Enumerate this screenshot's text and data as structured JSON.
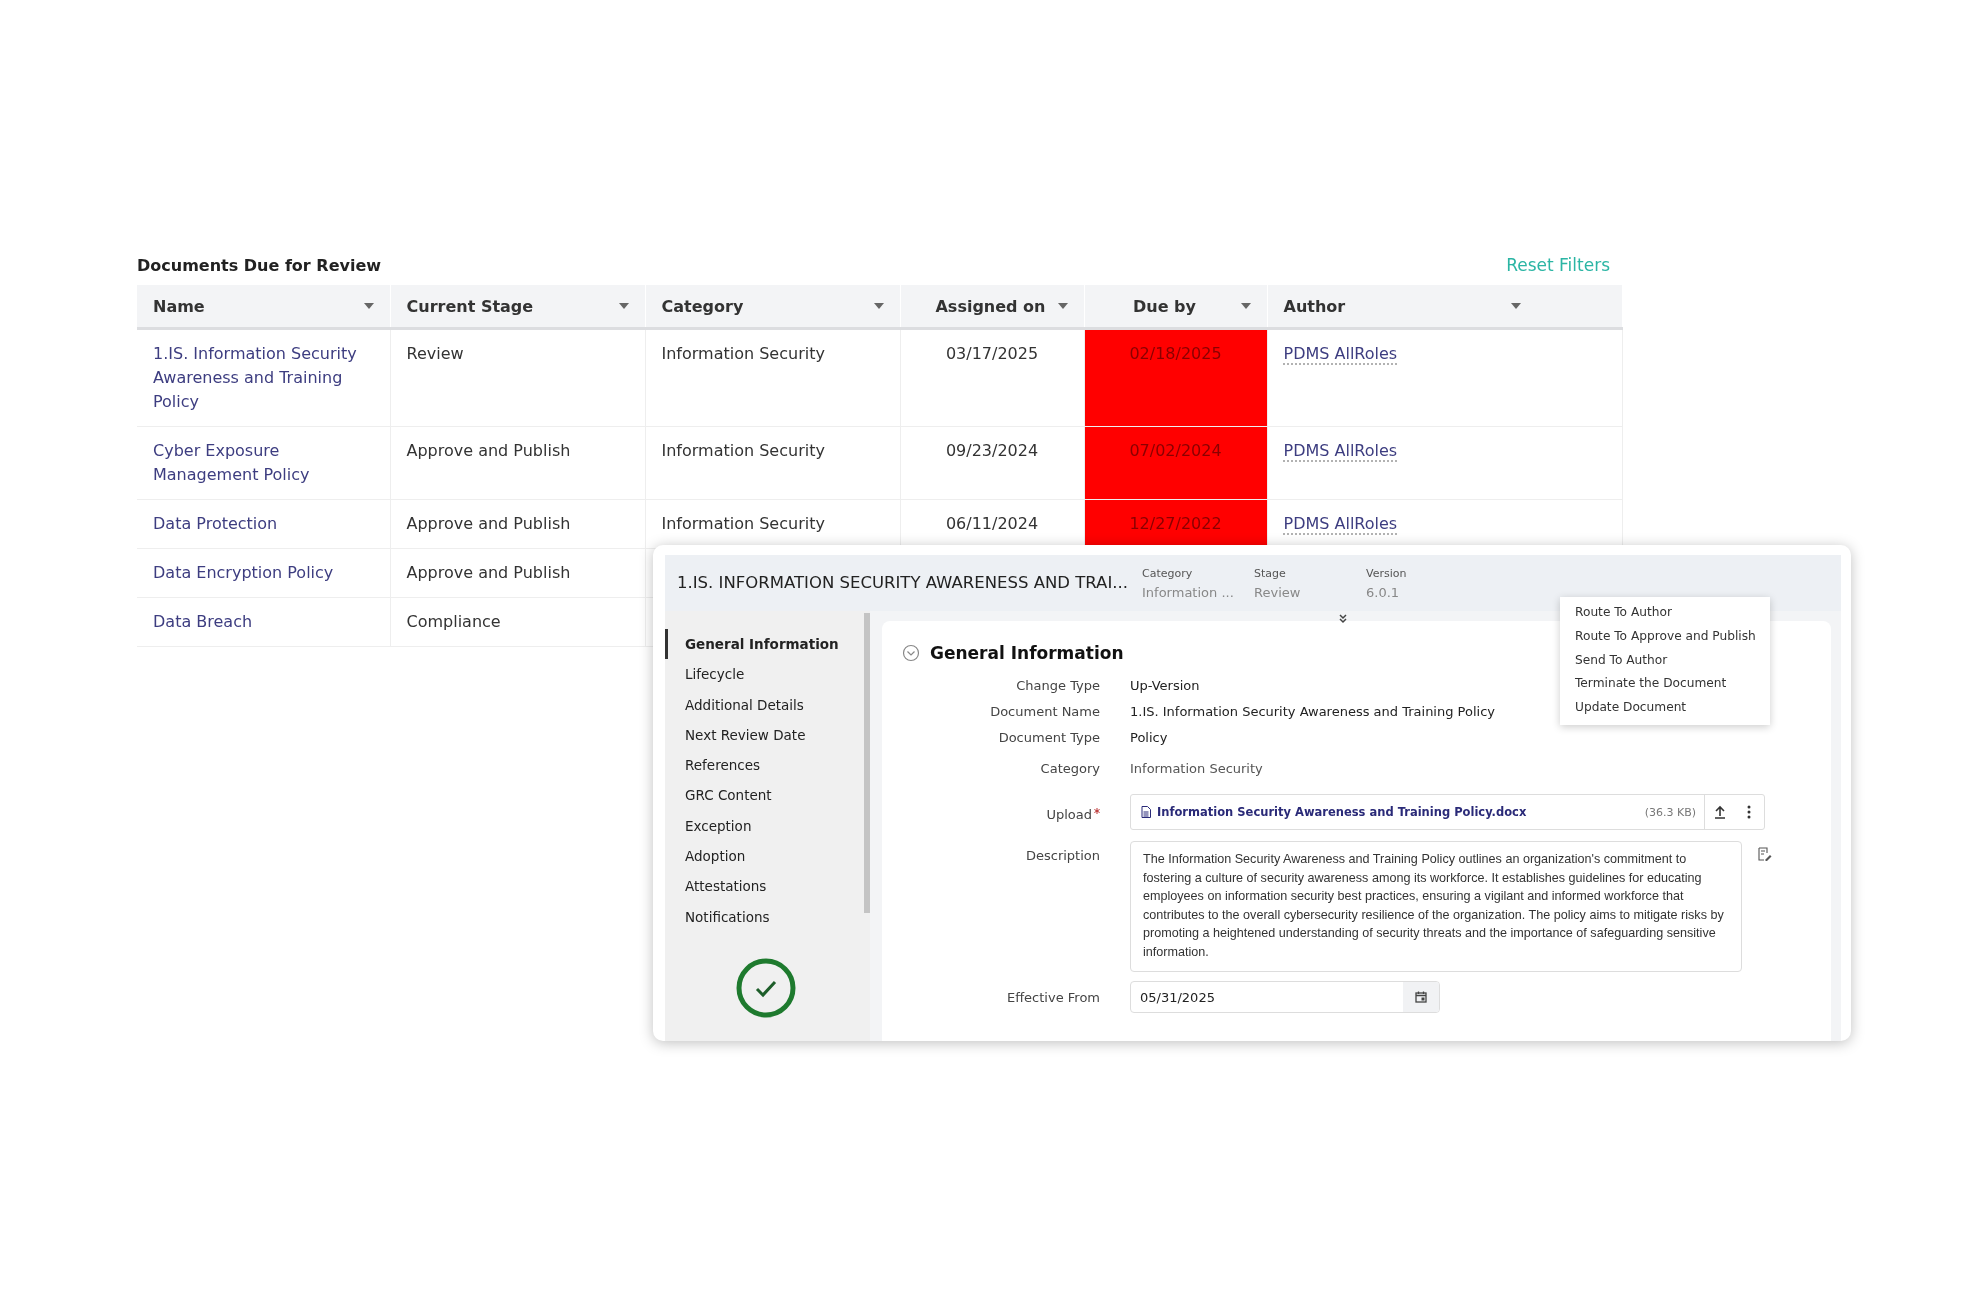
{
  "review_table": {
    "title": "Documents Due for Review",
    "reset_link": "Reset Filters",
    "columns": [
      {
        "label": "Name"
      },
      {
        "label": "Current Stage"
      },
      {
        "label": "Category"
      },
      {
        "label": "Assigned on"
      },
      {
        "label": "Due by"
      },
      {
        "label": "Author"
      }
    ],
    "rows": [
      {
        "name": "1.IS. Information Security Awareness and Training Policy",
        "current_stage": "Review",
        "category": "Information Security",
        "assigned_on": "03/17/2025",
        "due_by": "02/18/2025",
        "overdue": true,
        "author": "PDMS AllRoles"
      },
      {
        "name": "Cyber Exposure Management Policy",
        "current_stage": "Approve and Publish",
        "category": "Information Security",
        "assigned_on": "09/23/2024",
        "due_by": "07/02/2024",
        "overdue": true,
        "author": "PDMS AllRoles"
      },
      {
        "name": "Data Protection",
        "current_stage": "Approve and Publish",
        "category": "Information Security",
        "assigned_on": "06/11/2024",
        "due_by": "12/27/2022",
        "overdue": true,
        "author": "PDMS AllRoles"
      },
      {
        "name": "Data Encryption Policy",
        "current_stage": "Approve and Publish"
      },
      {
        "name": "Data Breach",
        "current_stage": "Compliance"
      }
    ]
  },
  "detail_panel": {
    "title": "1.IS. INFORMATION SECURITY AWARENESS AND TRAI...",
    "meta": [
      {
        "label": "Category",
        "value": "Information ..."
      },
      {
        "label": "Stage",
        "value": "Review"
      },
      {
        "label": "Version",
        "value": "6.0.1"
      }
    ],
    "nav": [
      {
        "label": "General Information",
        "selected": true
      },
      {
        "label": "Lifecycle",
        "selected": false
      },
      {
        "label": "Additional Details",
        "selected": false
      },
      {
        "label": "Next Review Date",
        "selected": false
      },
      {
        "label": "References",
        "selected": false
      },
      {
        "label": "GRC Content",
        "selected": false
      },
      {
        "label": "Exception",
        "selected": false
      },
      {
        "label": "Adoption",
        "selected": false
      },
      {
        "label": "Attestations",
        "selected": false
      },
      {
        "label": "Notifications",
        "selected": false
      }
    ],
    "section": {
      "title": "General Information",
      "fields": [
        {
          "kind": "text",
          "label": "Change Type",
          "value": "Up-Version"
        },
        {
          "kind": "text",
          "label": "Document Name",
          "value": "1.IS. Information Security Awareness and Training Policy"
        },
        {
          "kind": "text",
          "label": "Document Type",
          "value": "Policy"
        },
        {
          "kind": "readonly",
          "label": "Category",
          "value": "Information Security"
        },
        {
          "kind": "upload",
          "label": "Upload",
          "required": true,
          "value": "Information Security Awareness and Training Policy.docx",
          "size": "(36.3 KB)"
        },
        {
          "kind": "textarea",
          "label": "Description",
          "value": "The Information Security Awareness and Training Policy outlines an organization's commitment to fostering a culture of security awareness among its workforce. It establishes guidelines for educating employees on information security best practices, ensuring a vigilant and informed workforce that contributes to the overall cybersecurity resilience of the organization. The policy aims to mitigate risks by promoting a heightened understanding of security threats and the importance of safeguarding sensitive information."
        },
        {
          "kind": "date",
          "label": "Effective From",
          "value": "05/31/2025"
        }
      ]
    },
    "action_menu": [
      "Route To Author",
      "Route To Approve and Publish",
      "Send To Author",
      "Terminate the Document",
      "Update Document"
    ]
  }
}
